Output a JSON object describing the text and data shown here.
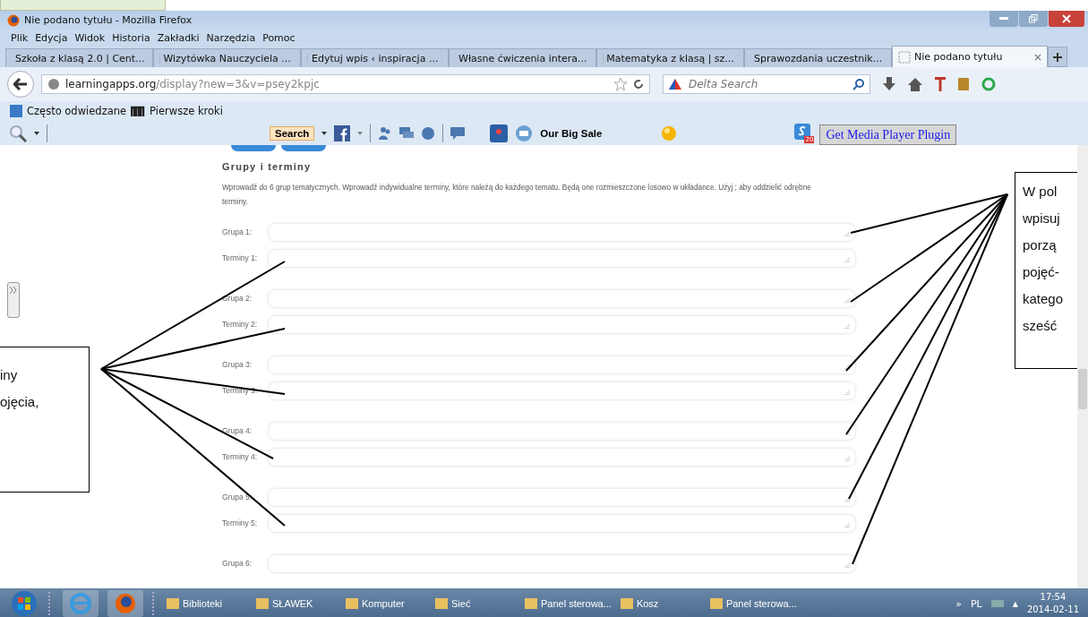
{
  "window": {
    "title": "Nie podano tytułu - Mozilla Firefox"
  },
  "menu": [
    "Plik",
    "Edycja",
    "Widok",
    "Historia",
    "Zakładki",
    "Narzędzia",
    "Pomoc"
  ],
  "tabs": [
    {
      "label": "Szkoła z klasą 2.0 | Cent...",
      "selected": false
    },
    {
      "label": "Wizytówka Nauczyciela ...",
      "selected": false
    },
    {
      "label": "Edytuj wpis ‹ inspiracja ...",
      "selected": false
    },
    {
      "label": "Własne ćwiczenia intera...",
      "selected": false
    },
    {
      "label": "Matematyka z klasą | sz...",
      "selected": false
    },
    {
      "label": "Sprawozdania uczestnik...",
      "selected": false
    },
    {
      "label": "Nie podano tytułu",
      "selected": true
    }
  ],
  "url": {
    "host": "learningapps.org",
    "path": "/display?new=3&v=psey2kpjc"
  },
  "search": {
    "placeholder": "Delta Search"
  },
  "bookmarks": [
    "Często odwiedzane",
    "Pierwsze kroki"
  ],
  "addon_bar": {
    "search_button": "Search",
    "sale": "Our Big Sale",
    "badge": "20",
    "plugin_button": "Get Media Player Plugin"
  },
  "form": {
    "title": "Grupy i terminy",
    "description": "Wprowadź do 6 grup tematycznych. Wprowadź indywidualne terminy, które należą do każdego tematu. Będą one rozmieszczone losowo w układance. Użyj ; aby oddzielić odrębne terminy.",
    "rows": [
      {
        "group": "Grupa 1:",
        "terms": "Terminy 1:"
      },
      {
        "group": "Grupa 2:",
        "terms": "Terminy 2:"
      },
      {
        "group": "Grupa 3:",
        "terms": "Terminy 3:"
      },
      {
        "group": "Grupa 4:",
        "terms": "Terminy 4:"
      },
      {
        "group": "Grupa 5:",
        "terms": "Terminy 5:"
      },
      {
        "group": "Grupa 6:"
      }
    ]
  },
  "callouts": {
    "left": [
      "iny",
      "ojęcia,"
    ],
    "right": [
      "W pol",
      "wpisuj",
      "porzą",
      "pojęć-",
      "katego",
      "sześć"
    ]
  },
  "taskbar": {
    "items": [
      "Biblioteki",
      "SŁAWEK",
      "Komputer",
      "Sieć",
      "Panel sterowa...",
      "Kosz",
      "Panel sterowa..."
    ],
    "overflow": "»",
    "language": "PL",
    "tray_arrow": "▲",
    "time": "17:54",
    "date": "2014-02-11"
  }
}
